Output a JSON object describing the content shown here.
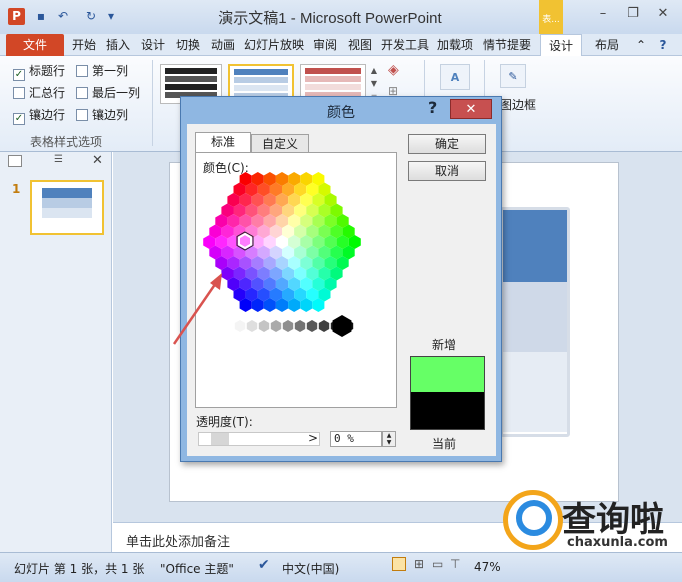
{
  "window": {
    "title": "演示文稿1 - Microsoft PowerPoint",
    "context_tab": "表...",
    "min": "–",
    "restore": "❐",
    "close": "✕"
  },
  "tabs": [
    {
      "label": "文件"
    },
    {
      "label": "开始"
    },
    {
      "label": "插入"
    },
    {
      "label": "设计"
    },
    {
      "label": "切换"
    },
    {
      "label": "动画"
    },
    {
      "label": "幻灯片放映"
    },
    {
      "label": "审阅"
    },
    {
      "label": "视图"
    },
    {
      "label": "开发工具"
    },
    {
      "label": "加载项"
    },
    {
      "label": "情节提要"
    },
    {
      "label": "设计"
    },
    {
      "label": "布局"
    }
  ],
  "ribbon": {
    "options": [
      {
        "label": "标题行",
        "checked": true
      },
      {
        "label": "汇总行",
        "checked": false
      },
      {
        "label": "镶边行",
        "checked": true
      },
      {
        "label": "第一列",
        "checked": false
      },
      {
        "label": "最后一列",
        "checked": false
      },
      {
        "label": "镶边列",
        "checked": false
      }
    ],
    "group_label": "表格样式选项",
    "border_label": "图边框",
    "checkmark": "✓"
  },
  "dialog": {
    "title": "颜色",
    "help": "?",
    "close": "✕",
    "tab_standard": "标准",
    "tab_custom": "自定义",
    "colors_label": "颜色(C):",
    "ok": "确定",
    "cancel": "取消",
    "new_label": "新增",
    "current_label": "当前",
    "new_color": "#66ff66",
    "current_color": "#000000",
    "transparency_label": "透明度(T):",
    "transparency_value": "0 %",
    "arrow_left": "<",
    "arrow_right": ">"
  },
  "slide_panel": {
    "number": "1"
  },
  "notes": {
    "placeholder": "单击此处添加备注"
  },
  "status": {
    "slide_info": "幻灯片 第 1 张，共 1 张",
    "theme": "\"Office 主题\"",
    "language": "中文(中国)",
    "zoom": "47%"
  },
  "watermark": {
    "text": "查询啦",
    "url": "chaxunla.com"
  }
}
